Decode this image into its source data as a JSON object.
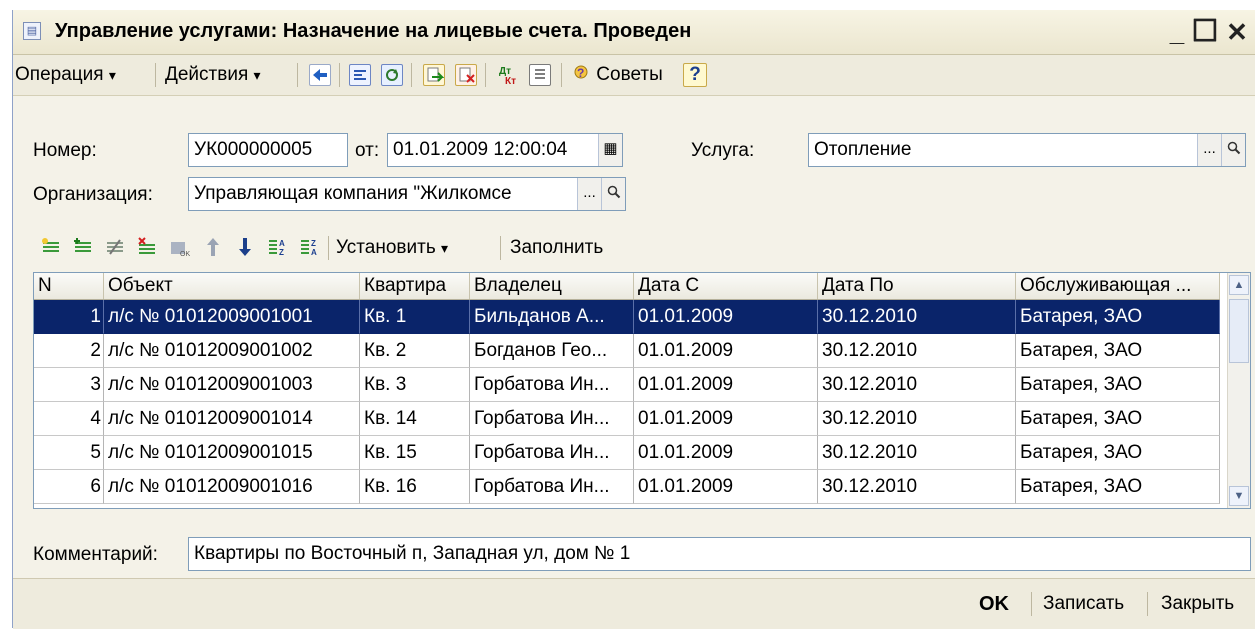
{
  "window": {
    "title": "Управление услугами: Назначение на лицевые счета. Проведен",
    "minimize_glyph": "_",
    "maximize_glyph": "☐",
    "close_glyph": "✕"
  },
  "toolbar": {
    "operation_label": "Операция",
    "actions_label": "Действия",
    "tips_label": "Советы",
    "help_label": "?",
    "dropdown_glyph": "▾"
  },
  "form": {
    "number_label": "Номер:",
    "number_value": "УК000000005",
    "date_label": "от:",
    "date_value": "01.01.2009 12:00:04",
    "service_label": "Услуга:",
    "service_value": "Отопление",
    "org_label": "Организация:",
    "org_value": "Управляющая компания \"Жилкомсе",
    "select_glyph": "...",
    "open_glyph": "🔍",
    "calendar_glyph": "▦"
  },
  "grid_toolbar": {
    "set_label": "Установить",
    "fill_label": "Заполнить"
  },
  "table": {
    "columns": [
      "N",
      "Объект",
      "Квартира",
      "Владелец",
      "Дата С",
      "Дата По",
      "Обслуживающая ..."
    ],
    "rows": [
      {
        "n": "1",
        "object": "л/с № 01012009001001",
        "flat": "Кв. 1",
        "owner": "Бильданов А...",
        "date_from": "01.01.2009",
        "date_to": "30.12.2010",
        "service_org": "Батарея, ЗАО"
      },
      {
        "n": "2",
        "object": "л/с № 01012009001002",
        "flat": "Кв. 2",
        "owner": "Богданов Гео...",
        "date_from": "01.01.2009",
        "date_to": "30.12.2010",
        "service_org": "Батарея, ЗАО"
      },
      {
        "n": "3",
        "object": "л/с № 01012009001003",
        "flat": "Кв. 3",
        "owner": "Горбатова Ин...",
        "date_from": "01.01.2009",
        "date_to": "30.12.2010",
        "service_org": "Батарея, ЗАО"
      },
      {
        "n": "4",
        "object": "л/с № 01012009001014",
        "flat": "Кв. 14",
        "owner": "Горбатова Ин...",
        "date_from": "01.01.2009",
        "date_to": "30.12.2010",
        "service_org": "Батарея, ЗАО"
      },
      {
        "n": "5",
        "object": "л/с № 01012009001015",
        "flat": "Кв. 15",
        "owner": "Горбатова Ин...",
        "date_from": "01.01.2009",
        "date_to": "30.12.2010",
        "service_org": "Батарея, ЗАО"
      },
      {
        "n": "6",
        "object": "л/с № 01012009001016",
        "flat": "Кв. 16",
        "owner": "Горбатова Ин...",
        "date_from": "01.01.2009",
        "date_to": "30.12.2010",
        "service_org": "Батарея, ЗАО"
      }
    ],
    "selected_row": 0
  },
  "comment": {
    "label": "Комментарий:",
    "value": "Квартиры по Восточный п, Западная ул, дом № 1"
  },
  "footer": {
    "ok_label": "OK",
    "save_label": "Записать",
    "close_label": "Закрыть"
  }
}
